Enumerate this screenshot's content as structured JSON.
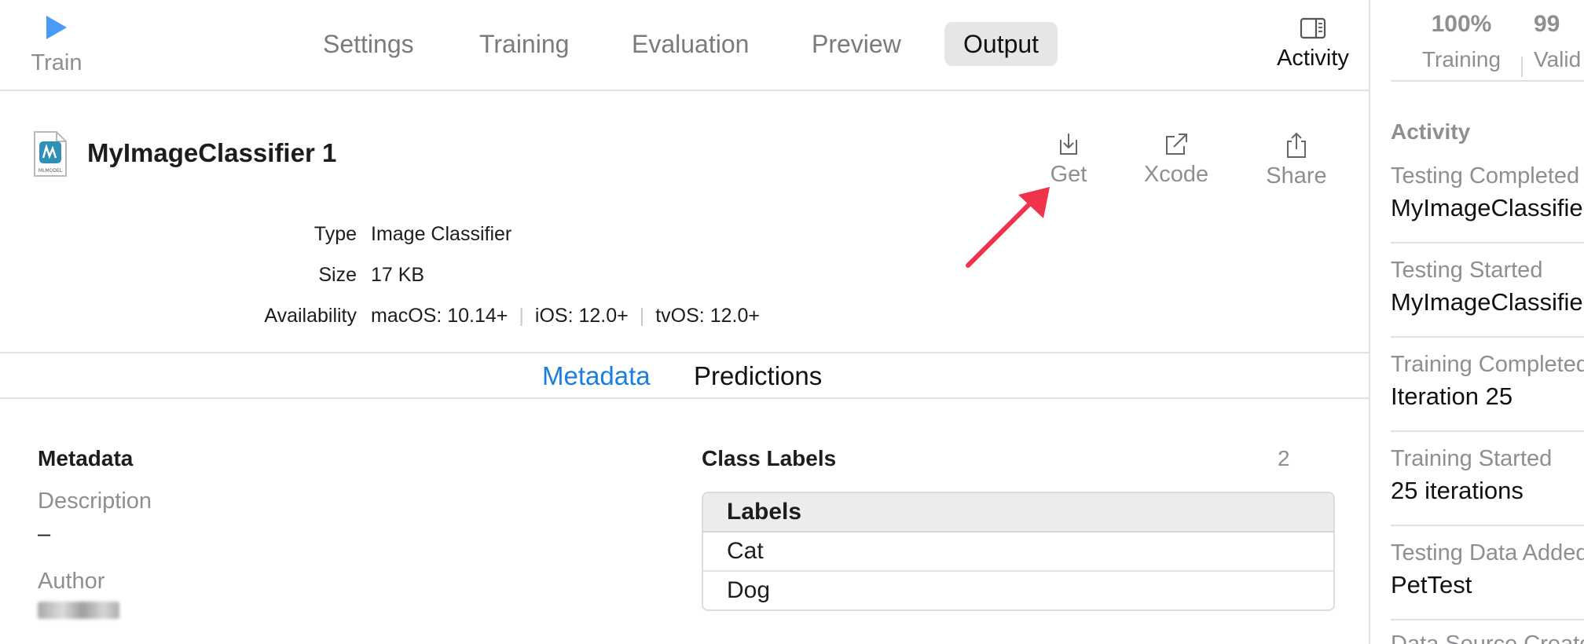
{
  "toolbar": {
    "train_label": "Train",
    "tabs": [
      "Settings",
      "Training",
      "Evaluation",
      "Preview",
      "Output"
    ],
    "active_tab": "Output",
    "activity_label": "Activity"
  },
  "model": {
    "name": "MyImageClassifier 1",
    "file_icon_caption": "MLMODEL",
    "actions": {
      "get": "Get",
      "xcode": "Xcode",
      "share": "Share"
    },
    "properties": {
      "type_key": "Type",
      "type_val": "Image Classifier",
      "size_key": "Size",
      "size_val": "17 KB",
      "avail_key": "Availability",
      "avail_macos": "macOS: 10.14+",
      "avail_ios": "iOS: 12.0+",
      "avail_tvos": "tvOS: 12.0+"
    }
  },
  "segments": {
    "metadata": "Metadata",
    "predictions": "Predictions",
    "selected": "Metadata"
  },
  "metadata": {
    "title": "Metadata",
    "description_label": "Description",
    "description_value": "–",
    "author_label": "Author"
  },
  "class_labels": {
    "title": "Class Labels",
    "count": "2",
    "header": "Labels",
    "rows": [
      "Cat",
      "Dog"
    ]
  },
  "activity_panel": {
    "stats": [
      {
        "value": "100%",
        "label": "Training"
      },
      {
        "value": "99",
        "label": "Valid"
      }
    ],
    "title": "Activity",
    "items": [
      {
        "title": "Testing Completed",
        "detail": "MyImageClassifier"
      },
      {
        "title": "Testing Started",
        "detail": "MyImageClassifier"
      },
      {
        "title": "Training Completed",
        "detail": "Iteration 25"
      },
      {
        "title": "Training Started",
        "detail": "25 iterations"
      },
      {
        "title": "Testing Data Added",
        "detail": "PetTest"
      },
      {
        "title": "Data Source Created",
        "detail": ""
      }
    ]
  },
  "colors": {
    "accent": "#1a7fe0",
    "annotation_arrow": "#f0334b",
    "play": "#4a9bf5"
  }
}
